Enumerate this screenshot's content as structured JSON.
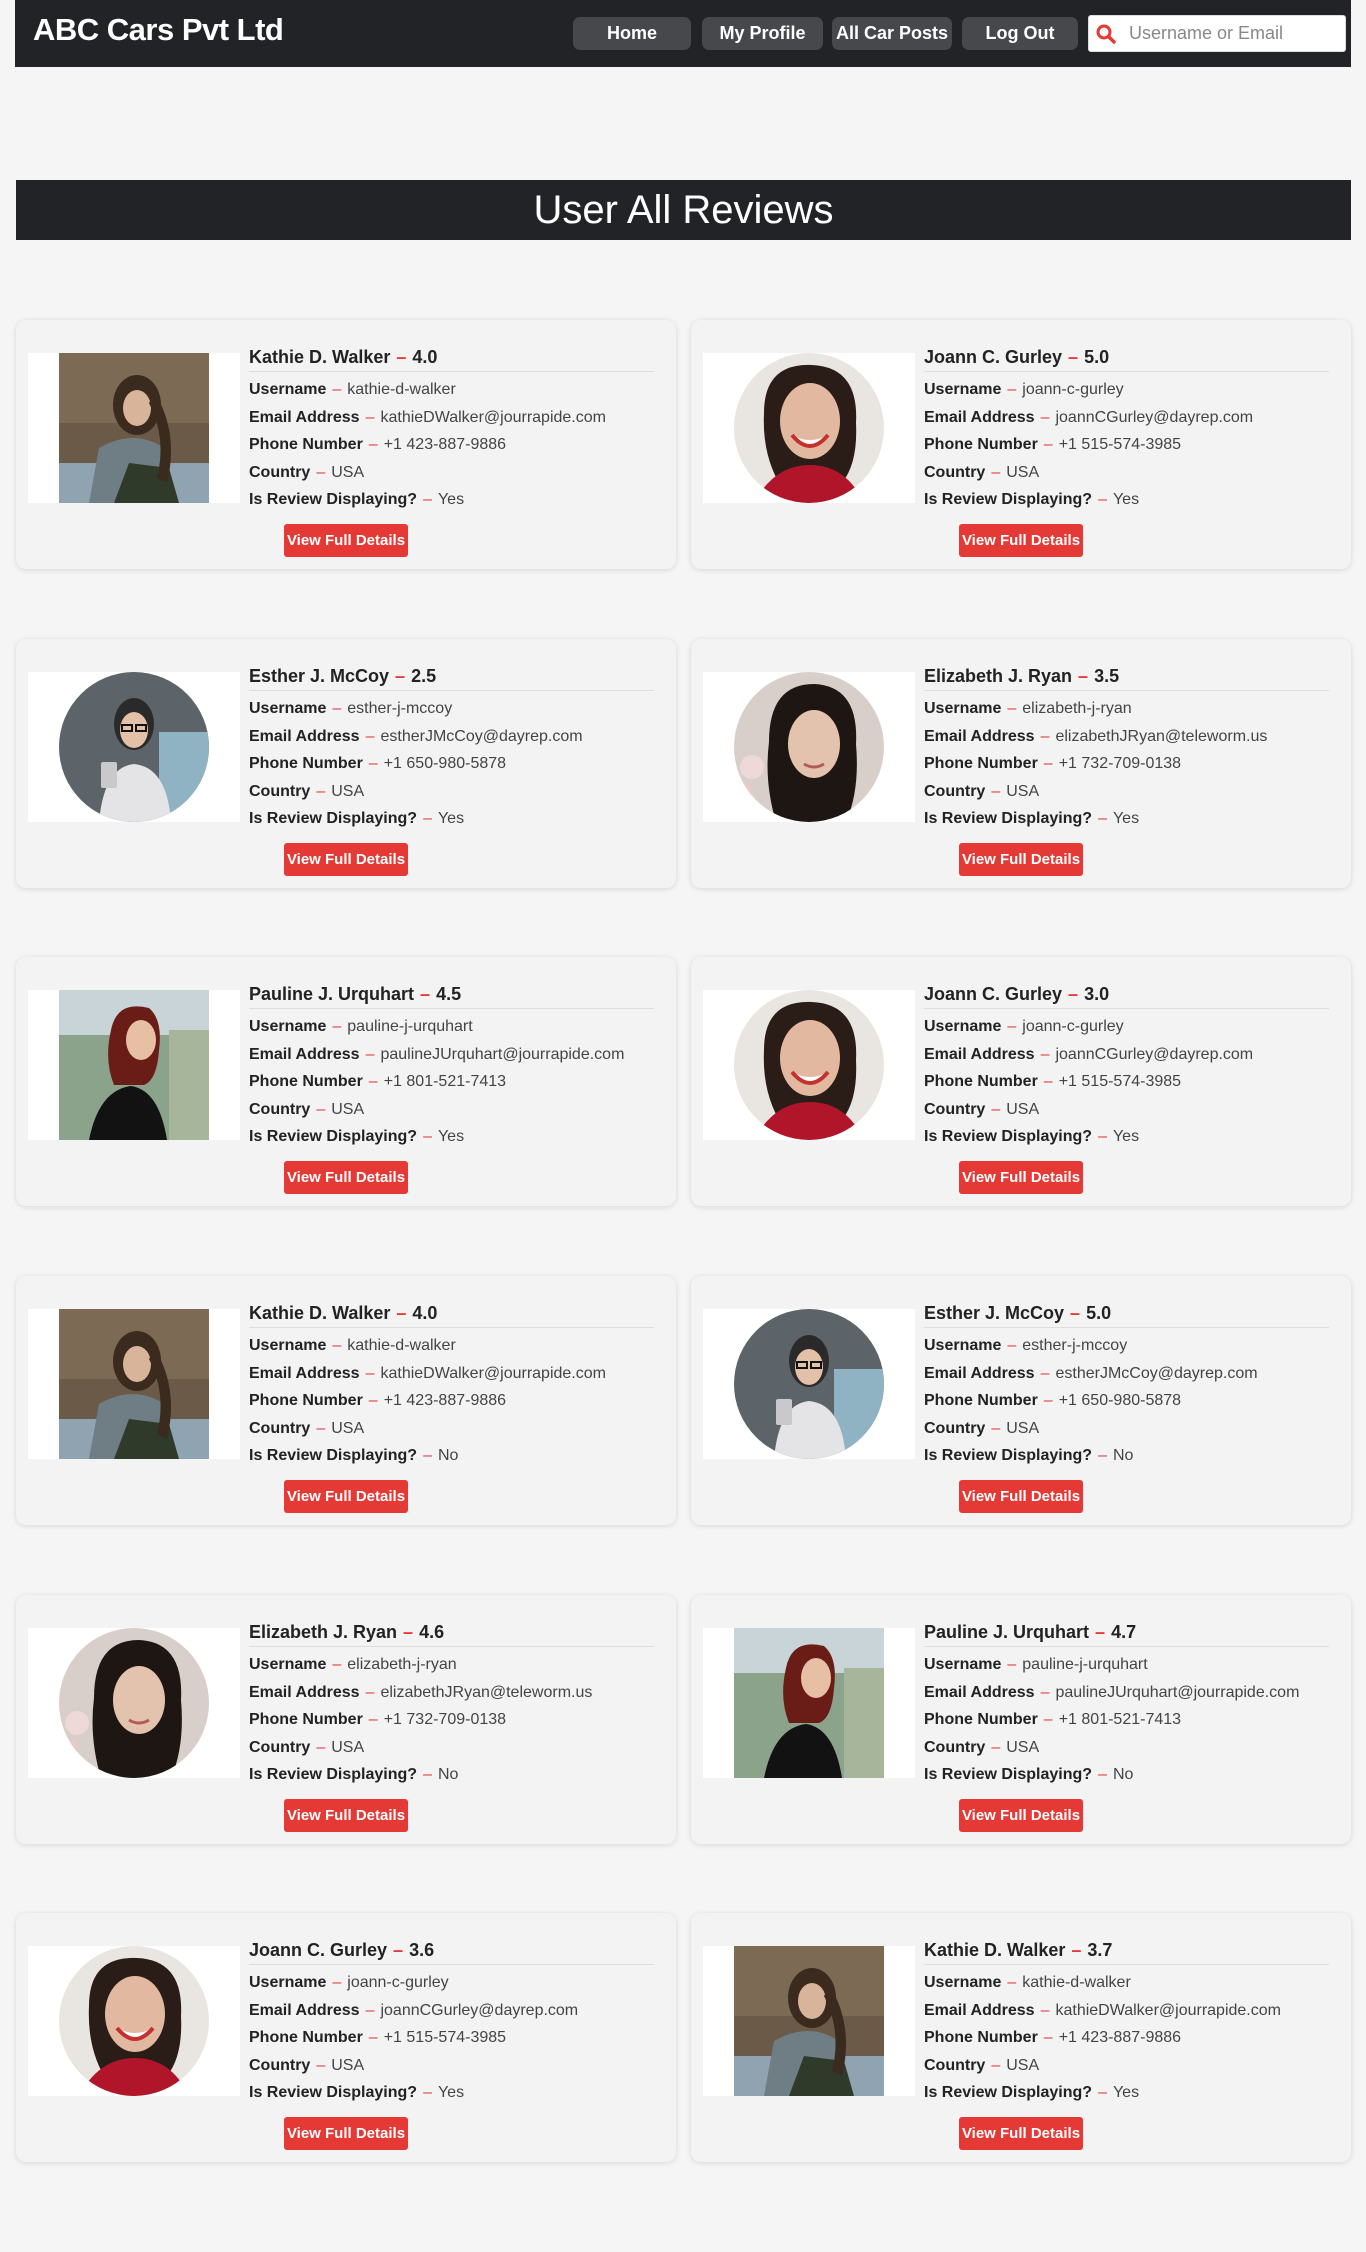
{
  "navbar": {
    "brand": "ABC Cars Pvt Ltd",
    "links": [
      "Home",
      "My Profile",
      "All Car Posts",
      "Log Out"
    ],
    "search_placeholder": "Username or Email",
    "search_icon": "search-icon"
  },
  "page": {
    "title": "User All Reviews"
  },
  "labels": {
    "username": "Username",
    "email": "Email Address",
    "phone": "Phone Number",
    "country": "Country",
    "displaying": "Is Review Displaying?",
    "separator": "–",
    "button": "View Full Details"
  },
  "colors": {
    "navbar": "#222326",
    "accent": "#e53935",
    "background": "#f5f5f5"
  },
  "reviews": [
    {
      "name": "Kathie D. Walker",
      "rating": "4.0",
      "username": "kathie-d-walker",
      "email": "kathieDWalker@jourrapide.com",
      "phone": "+1 423-887-9886",
      "country": "USA",
      "displaying": "Yes"
    },
    {
      "name": "Joann C. Gurley",
      "rating": "5.0",
      "username": "joann-c-gurley",
      "email": "joannCGurley@dayrep.com",
      "phone": "+1 515-574-3985",
      "country": "USA",
      "displaying": "Yes"
    },
    {
      "name": "Esther J. McCoy",
      "rating": "2.5",
      "username": "esther-j-mccoy",
      "email": "estherJMcCoy@dayrep.com",
      "phone": "+1 650-980-5878",
      "country": "USA",
      "displaying": "Yes"
    },
    {
      "name": "Elizabeth J. Ryan",
      "rating": "3.5",
      "username": "elizabeth-j-ryan",
      "email": "elizabethJRyan@teleworm.us",
      "phone": "+1 732-709-0138",
      "country": "USA",
      "displaying": "Yes"
    },
    {
      "name": "Pauline J. Urquhart",
      "rating": "4.5",
      "username": "pauline-j-urquhart",
      "email": "paulineJUrquhart@jourrapide.com",
      "phone": "+1 801-521-7413",
      "country": "USA",
      "displaying": "Yes"
    },
    {
      "name": "Joann C. Gurley",
      "rating": "3.0",
      "username": "joann-c-gurley",
      "email": "joannCGurley@dayrep.com",
      "phone": "+1 515-574-3985",
      "country": "USA",
      "displaying": "Yes"
    },
    {
      "name": "Kathie D. Walker",
      "rating": "4.0",
      "username": "kathie-d-walker",
      "email": "kathieDWalker@jourrapide.com",
      "phone": "+1 423-887-9886",
      "country": "USA",
      "displaying": "No"
    },
    {
      "name": "Esther J. McCoy",
      "rating": "5.0",
      "username": "esther-j-mccoy",
      "email": "estherJMcCoy@dayrep.com",
      "phone": "+1 650-980-5878",
      "country": "USA",
      "displaying": "No"
    },
    {
      "name": "Elizabeth J. Ryan",
      "rating": "4.6",
      "username": "elizabeth-j-ryan",
      "email": "elizabethJRyan@teleworm.us",
      "phone": "+1 732-709-0138",
      "country": "USA",
      "displaying": "No"
    },
    {
      "name": "Pauline J. Urquhart",
      "rating": "4.7",
      "username": "pauline-j-urquhart",
      "email": "paulineJUrquhart@jourrapide.com",
      "phone": "+1 801-521-7413",
      "country": "USA",
      "displaying": "No"
    },
    {
      "name": "Joann C. Gurley",
      "rating": "3.6",
      "username": "joann-c-gurley",
      "email": "joannCGurley@dayrep.com",
      "phone": "+1 515-574-3985",
      "country": "USA",
      "displaying": "Yes"
    },
    {
      "name": "Kathie D. Walker",
      "rating": "3.7",
      "username": "kathie-d-walker",
      "email": "kathieDWalker@jourrapide.com",
      "phone": "+1 423-887-9886",
      "country": "USA",
      "displaying": "Yes"
    }
  ]
}
